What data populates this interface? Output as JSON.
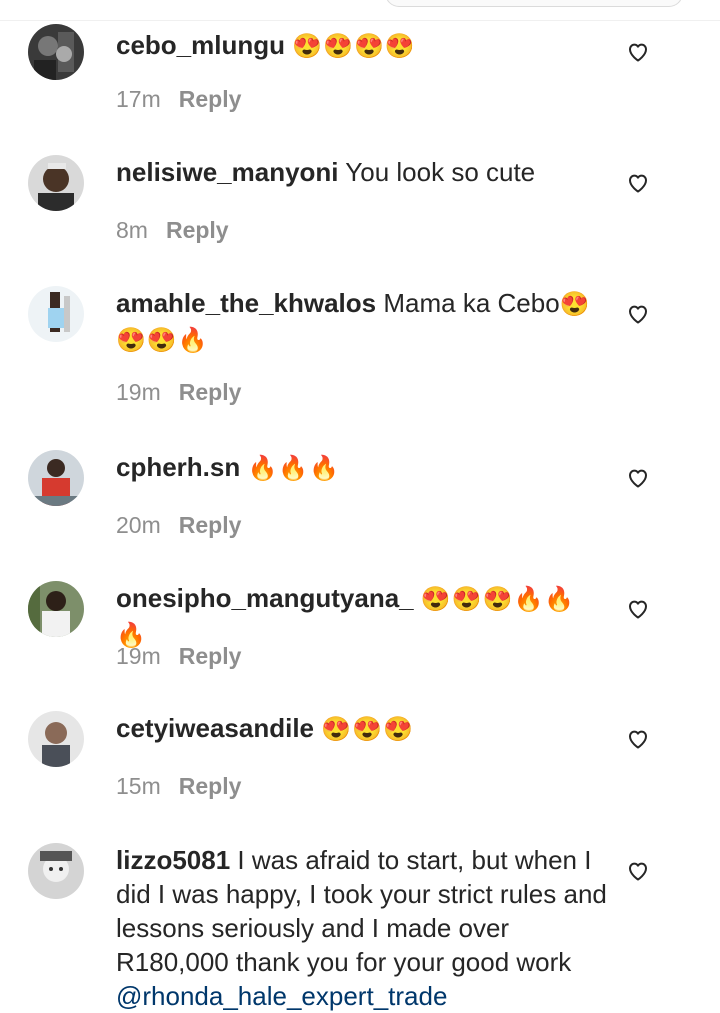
{
  "comments": [
    {
      "username": "cebo_mlungu",
      "text": "",
      "emoji": "😍😍😍😍",
      "time": "17m",
      "reply": "Reply"
    },
    {
      "username": "nelisiwe_manyoni",
      "text": "You look so cute",
      "emoji": "",
      "time": "8m",
      "reply": "Reply"
    },
    {
      "username": "amahle_the_khwalos",
      "text": "Mama ka Cebo",
      "emoji": "😍😍😍🔥",
      "time": "19m",
      "reply": "Reply"
    },
    {
      "username": "cpherh.sn",
      "text": "",
      "emoji": "🔥🔥🔥",
      "time": "20m",
      "reply": "Reply"
    },
    {
      "username": "onesipho_mangutyana_",
      "text": "",
      "emoji": "😍😍😍🔥🔥🔥",
      "time": "19m",
      "reply": "Reply"
    },
    {
      "username": "cetyiweasandile",
      "text": "",
      "emoji": "😍😍😍",
      "time": "15m",
      "reply": "Reply"
    },
    {
      "username": "lizzo5081",
      "text": "I was afraid to start, but when I did I was happy, I took your strict rules and lessons seriously and I made over R180,000 thank you for your good work",
      "mention": "@rhonda_hale_expert_trade",
      "emoji": "",
      "time": "",
      "reply": ""
    }
  ],
  "colors": {
    "text": "#262626",
    "meta": "#8e8e8e",
    "mention": "#00376b",
    "background": "#ffffff"
  },
  "icons": {
    "like": "heart-outline-icon"
  }
}
